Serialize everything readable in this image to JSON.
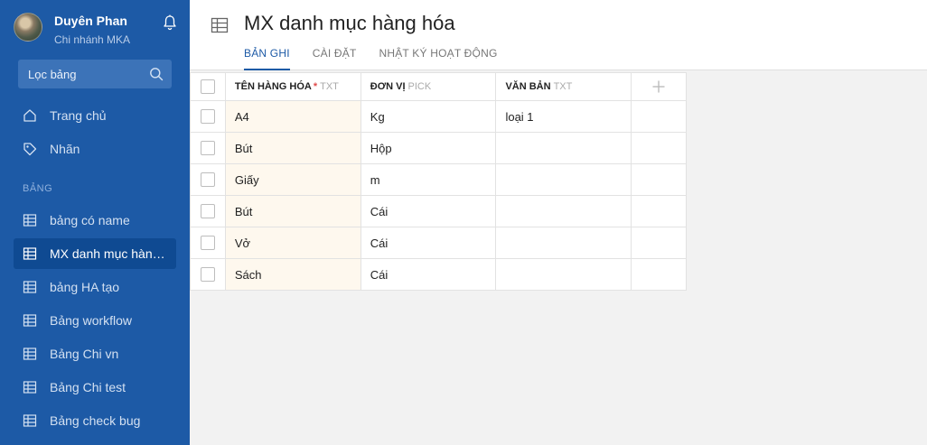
{
  "user": {
    "name": "Duyên Phan",
    "branch": "Chi nhánh MKA"
  },
  "sidebar": {
    "filter_placeholder": "Lọc bảng",
    "nav": [
      {
        "label": "Trang chủ",
        "icon": "home-icon"
      },
      {
        "label": "Nhãn",
        "icon": "tag-icon"
      }
    ],
    "section_label": "BẢNG",
    "tables": [
      {
        "label": "bảng có name",
        "active": false
      },
      {
        "label": "MX danh mục hàng hóa",
        "active": true
      },
      {
        "label": "bảng HA tạo",
        "active": false
      },
      {
        "label": "Bảng workflow",
        "active": false
      },
      {
        "label": "Bảng Chi vn",
        "active": false
      },
      {
        "label": "Bảng Chi test",
        "active": false
      },
      {
        "label": "Bảng check bug",
        "active": false
      }
    ]
  },
  "page": {
    "title": "MX danh mục hàng hóa",
    "tabs": [
      {
        "label": "BẢN GHI",
        "active": true
      },
      {
        "label": "CÀI ĐẶT",
        "active": false
      },
      {
        "label": "NHẬT KÝ HOẠT ĐỘNG",
        "active": false
      }
    ]
  },
  "grid": {
    "columns": [
      {
        "name": "TÊN HÀNG HÓA",
        "required": "*",
        "type": "TXT"
      },
      {
        "name": "ĐƠN VỊ",
        "required": "",
        "type": "PICK"
      },
      {
        "name": "VĂN BẢN",
        "required": "",
        "type": "TXT"
      }
    ],
    "rows": [
      [
        "A4",
        "Kg",
        "loại 1"
      ],
      [
        "Bút",
        "Hộp",
        ""
      ],
      [
        "Giấy",
        "m",
        ""
      ],
      [
        "Bút",
        "Cái",
        ""
      ],
      [
        "Vở",
        "Cái",
        ""
      ],
      [
        "Sách",
        "Cái",
        ""
      ]
    ]
  },
  "colors": {
    "sidebar": "#1d5aa6",
    "sidebar_active": "#0f4a92",
    "accent": "#1d5aa6",
    "primary_column": "#fef8ee"
  }
}
